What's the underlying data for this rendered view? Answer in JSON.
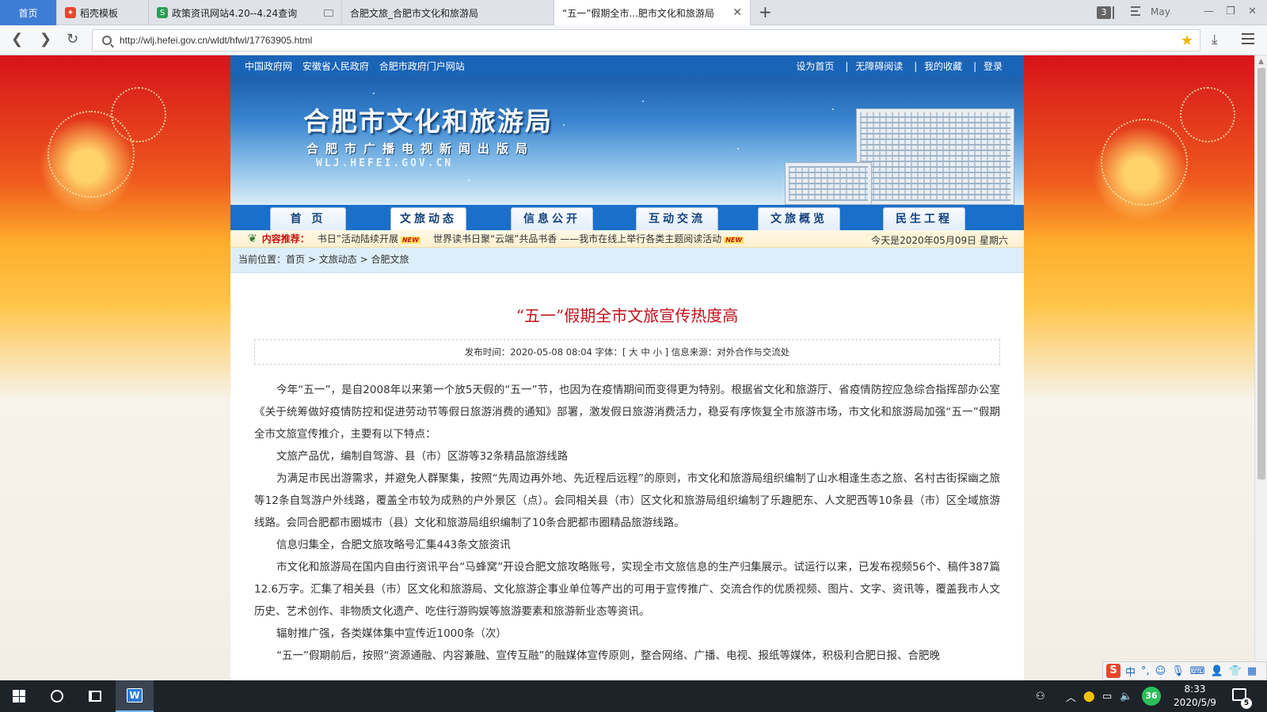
{
  "browser": {
    "tabs": [
      {
        "label": "首页"
      },
      {
        "label": "稻壳模板",
        "icon": "daoke-icon",
        "icon_color": "#e8462b"
      },
      {
        "label": "政策资讯网站4.20--4.24查询",
        "icon": "s-icon",
        "icon_color": "#2e9d52"
      },
      {
        "label": "合肥文旅_合肥市文化和旅游局"
      },
      {
        "label": "“五一”假期全市...肥市文化和旅游局"
      }
    ],
    "tab_count": "3",
    "profile_label": "May",
    "url": "http://wlj.hefei.gov.cn/wldt/hfwl/17763905.html"
  },
  "site": {
    "top_links": [
      "中国政府网",
      "安徽省人民政府",
      "合肥市政府门户网站"
    ],
    "top_right_links": [
      "设为首页",
      "无障碍阅读",
      "我的收藏",
      "登录"
    ],
    "separator": "|",
    "banner": {
      "title": "合肥市文化和旅游局",
      "subtitle": "合肥市广播电视新闻出版局",
      "domain": "WLJ.HEFEI.GOV.CN"
    },
    "nav": [
      "首 页",
      "文旅动态",
      "信息公开",
      "互动交流",
      "文旅概览",
      "民生工程"
    ],
    "ticker": {
      "label": "内容推荐：",
      "items": [
        "书日”活动陆续开展",
        "世界读书日聚“云端”共品书香 ——我市在线上举行各类主题阅读活动"
      ],
      "new_badge": "NEW",
      "date": "今天是2020年05月09日 星期六"
    },
    "breadcrumb": {
      "prefix": "当前位置：",
      "items": [
        "首页",
        "文旅动态",
        "合肥文旅"
      ],
      "separator": ">"
    }
  },
  "article": {
    "title": "“五一”假期全市文旅宣传热度高",
    "meta": {
      "publish_label": "发布时间：",
      "publish_time": "2020-05-08 08:04",
      "font_label": "字体：[",
      "font_sizes": [
        "大",
        "中",
        "小"
      ],
      "font_close": "]",
      "source_label": "信息来源：",
      "source": "对外合作与交流处"
    },
    "paragraphs": [
      "今年“五一”，是自2008年以来第一个放5天假的“五一”节，也因为在疫情期间而变得更为特别。根据省文化和旅游厅、省疫情防控应急综合指挥部办公室《关于统筹做好疫情防控和促进劳动节等假日旅游消费的通知》部署，激发假日旅游消费活力，稳妥有序恢复全市旅游市场，市文化和旅游局加强“五一”假期全市文旅宣传推介，主要有以下特点：",
      "文旅产品优，编制自驾游、县（市）区游等32条精品旅游线路",
      "为满足市民出游需求，并避免人群聚集，按照“先周边再外地、先近程后远程”的原则，市文化和旅游局组织编制了山水相逢生态之旅、名村古街探幽之旅等12条自驾游户外线路，覆盖全市较为成熟的户外景区（点）。会同相关县（市）区文化和旅游局组织编制了乐趣肥东、人文肥西等10条县（市）区全域旅游线路。会同合肥都市圈城市（县）文化和旅游局组织编制了10条合肥都市圈精品旅游线路。",
      "信息归集全，合肥文旅攻略号汇集443条文旅资讯",
      "市文化和旅游局在国内自由行资讯平台“马蜂窝”开设合肥文旅攻略账号，实现全市文旅信息的生产归集展示。试运行以来，已发布视频56个、稿件387篇12.6万字。汇集了相关县（市）区文化和旅游局、文化旅游企事业单位等产出的可用于宣传推广、交流合作的优质视频、图片、文字、资讯等，覆盖我市人文历史、艺术创作、非物质文化遗产、吃住行游购娱等旅游要素和旅游新业态等资讯。",
      "辐射推广强，各类媒体集中宣传近1000条（次）",
      "“五一”假期前后，按照“资源通融、内容兼融、宣传互融”的融媒体宣传原则，整合网络、广播、电视、报纸等媒体，积极利合肥日报、合肥晚"
    ]
  },
  "ime": {
    "mode": "中",
    "punct": "°,"
  },
  "taskbar": {
    "tray_badge": "36",
    "time": "8:33",
    "date": "2020/5/9",
    "notifications": "5"
  },
  "colors": {
    "accent_blue": "#1a64b8",
    "title_red": "#c1121b",
    "ticker_label_red": "#c41212"
  }
}
